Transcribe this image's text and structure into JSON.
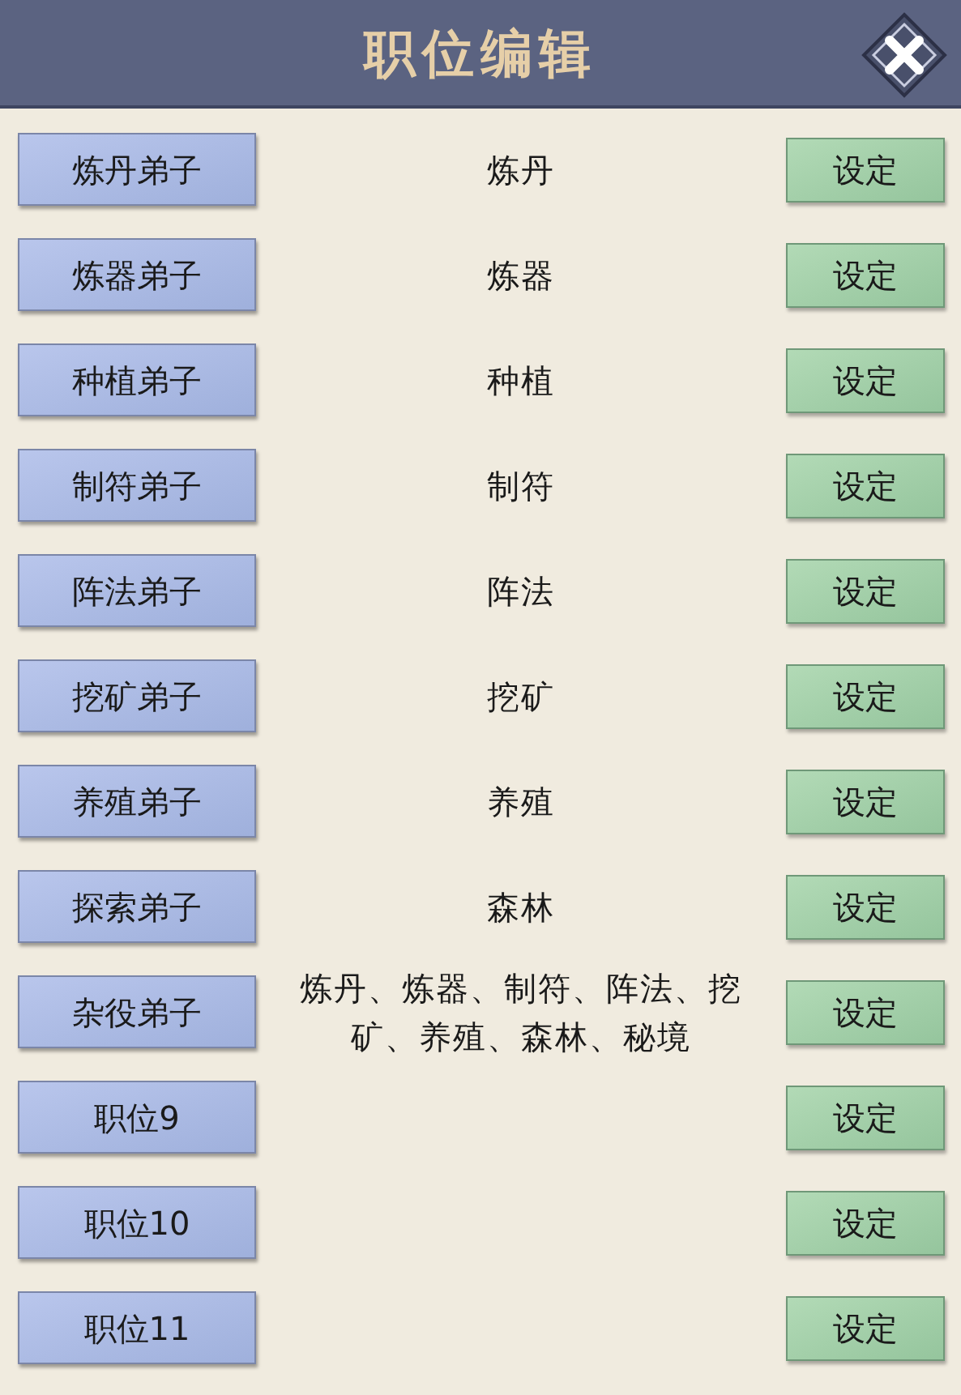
{
  "window": {
    "title": "职位编辑"
  },
  "rows": [
    {
      "position": "炼丹弟子",
      "duties": "炼丹",
      "button": "设定"
    },
    {
      "position": "炼器弟子",
      "duties": "炼器",
      "button": "设定"
    },
    {
      "position": "种植弟子",
      "duties": "种植",
      "button": "设定"
    },
    {
      "position": "制符弟子",
      "duties": "制符",
      "button": "设定"
    },
    {
      "position": "阵法弟子",
      "duties": "阵法",
      "button": "设定"
    },
    {
      "position": "挖矿弟子",
      "duties": "挖矿",
      "button": "设定"
    },
    {
      "position": "养殖弟子",
      "duties": "养殖",
      "button": "设定"
    },
    {
      "position": "探索弟子",
      "duties": "森林",
      "button": "设定"
    },
    {
      "position": "杂役弟子",
      "duties": "炼丹、炼器、制符、阵法、挖矿、养殖、森林、秘境",
      "button": "设定"
    },
    {
      "position": "职位9",
      "button": "设定"
    },
    {
      "position": "职位10",
      "button": "设定"
    },
    {
      "position": "职位11",
      "button": "设定"
    }
  ]
}
